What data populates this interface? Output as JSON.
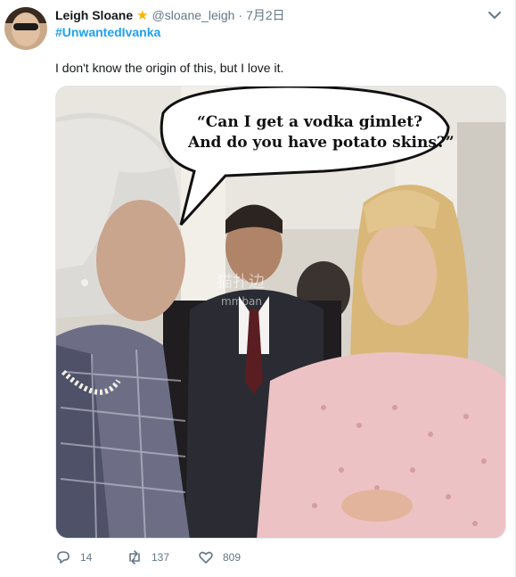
{
  "user": {
    "name": "Leigh Sloane",
    "handle": "@sloane_leigh",
    "date": "7月2日"
  },
  "tweet": {
    "hashtag": "#UnwantedIvanka",
    "text": "I don't know the origin of this, but I love it."
  },
  "image": {
    "speech_line1": "“Can I get a vodka gimlet?",
    "speech_line2": "And do you have potato skins?”",
    "watermark_line1": "猫扑边",
    "watermark_line2": "mmban"
  },
  "actions": {
    "replies": "14",
    "retweets": "137",
    "likes": "809"
  },
  "colors": {
    "link": "#1da1f2",
    "muted": "#657786",
    "verified_star": "#f5b400"
  }
}
